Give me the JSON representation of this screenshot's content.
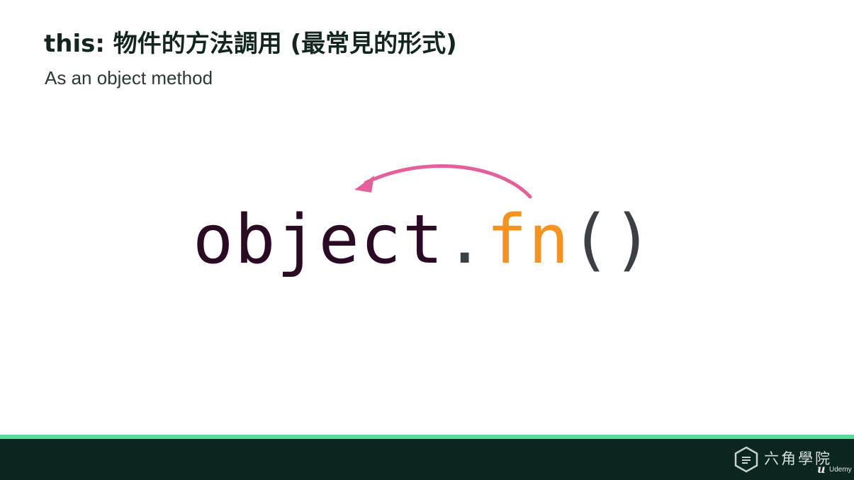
{
  "slide": {
    "title": "this: 物件的方法調用 (最常見的形式)",
    "subtitle": "As an object method"
  },
  "code": {
    "object": "object",
    "dot": ".",
    "fn": "fn",
    "parens": "()"
  },
  "footer": {
    "logo_text": "六角學院",
    "udemy_mark": "u",
    "udemy_label": "Udemy"
  },
  "colors": {
    "title": "#12261f",
    "object_text": "#2b0a23",
    "fn_text": "#f7921e",
    "arrow": "#e5609b",
    "accent_strip": "#5fd69b",
    "footer_bg": "#0b2520"
  },
  "icons": {
    "arrow": "curved-arrow-icon",
    "logo": "hexagon-logo-icon"
  }
}
